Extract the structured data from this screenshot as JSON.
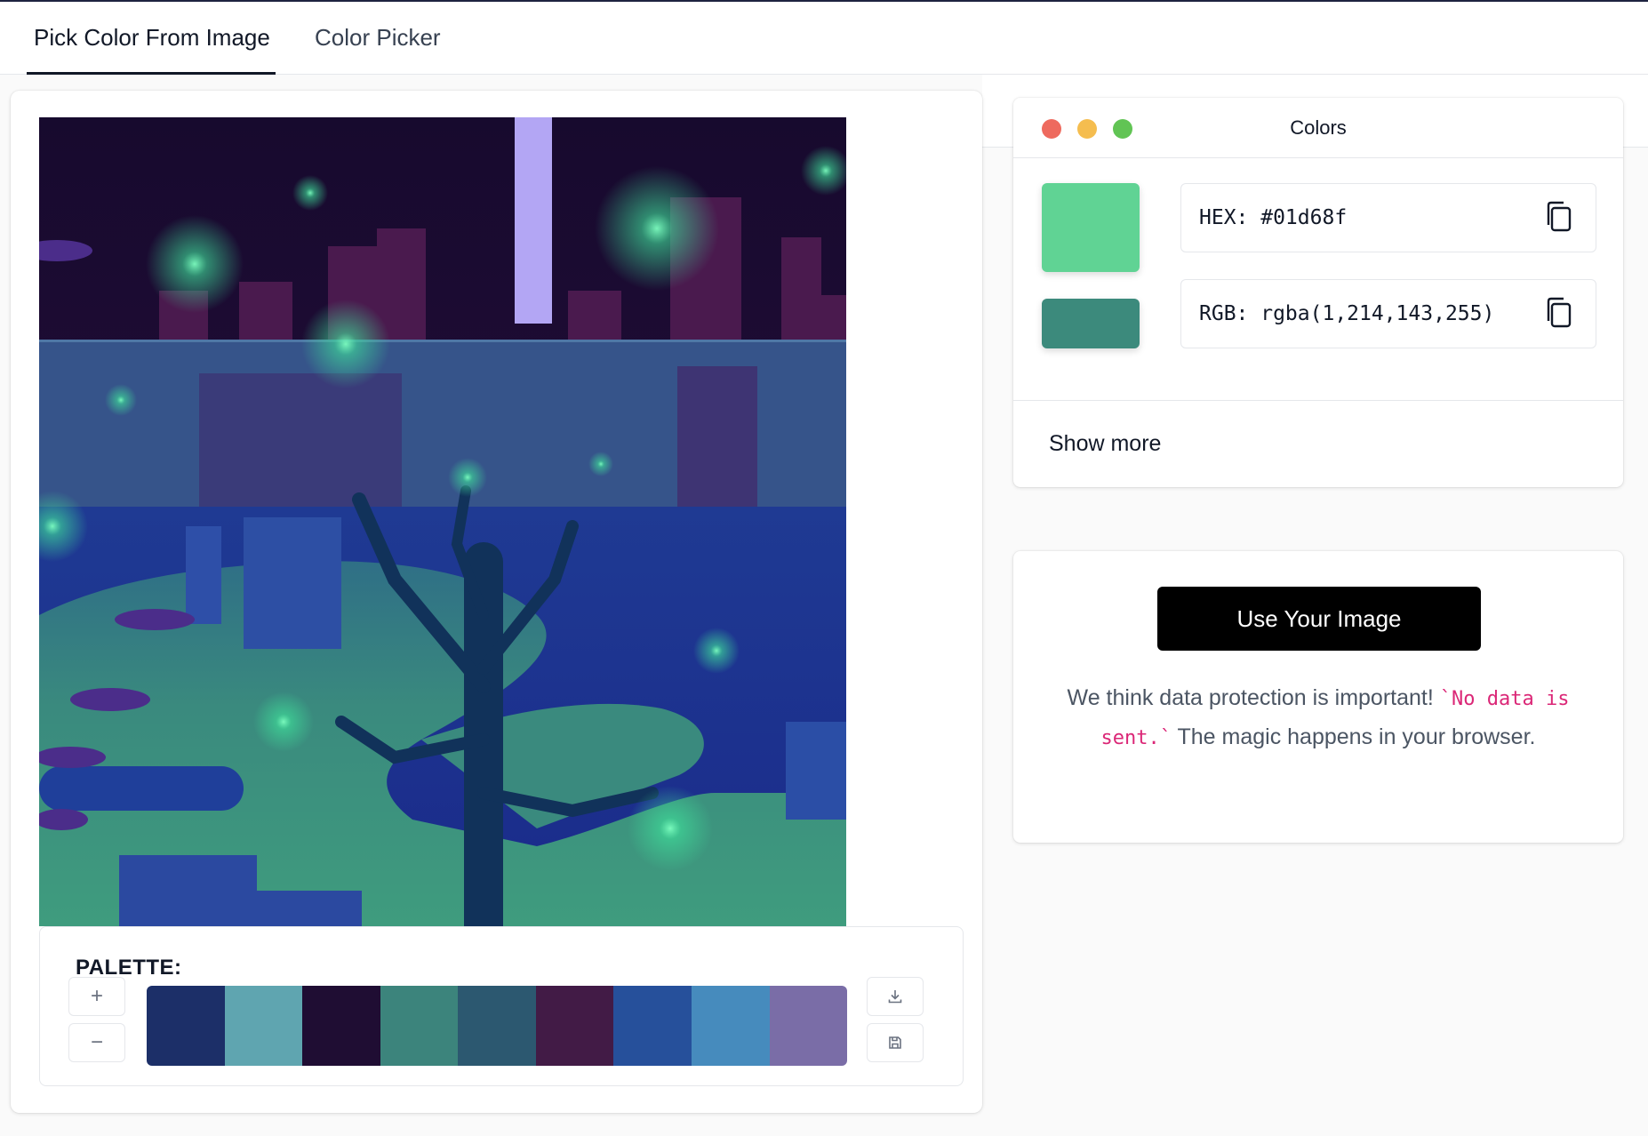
{
  "tabs": [
    {
      "label": "Pick Color From Image",
      "active": true
    },
    {
      "label": "Color Picker",
      "active": false
    }
  ],
  "palette": {
    "label": "PALETTE:",
    "add_icon": "plus-icon",
    "remove_icon": "minus-icon",
    "download_icon": "download-icon",
    "save_icon": "save-icon",
    "swatches": [
      "#1c2f68",
      "#5fa5b0",
      "#1f0d33",
      "#3c847c",
      "#2c5870",
      "#421b46",
      "#26509b",
      "#468bbd",
      "#7a6da7"
    ]
  },
  "colors_card": {
    "title": "Colors",
    "window_dots": [
      "#ee6a5e",
      "#f5bd4f",
      "#61c454"
    ],
    "primary_swatch": "#60d394",
    "secondary_swatch": "#3c8a7c",
    "hex_text": "HEX: #01d68f",
    "rgb_text": "RGB: rgba(1,214,143,255)",
    "show_more": "Show more"
  },
  "use_card": {
    "button_label": "Use Your Image",
    "privacy_before": "We think data protection is important!",
    "privacy_code": "`No data is sent.`",
    "privacy_after": "The magic happens in your browser."
  },
  "colors": {
    "accent": "#000000",
    "code_pink": "#db2777"
  }
}
